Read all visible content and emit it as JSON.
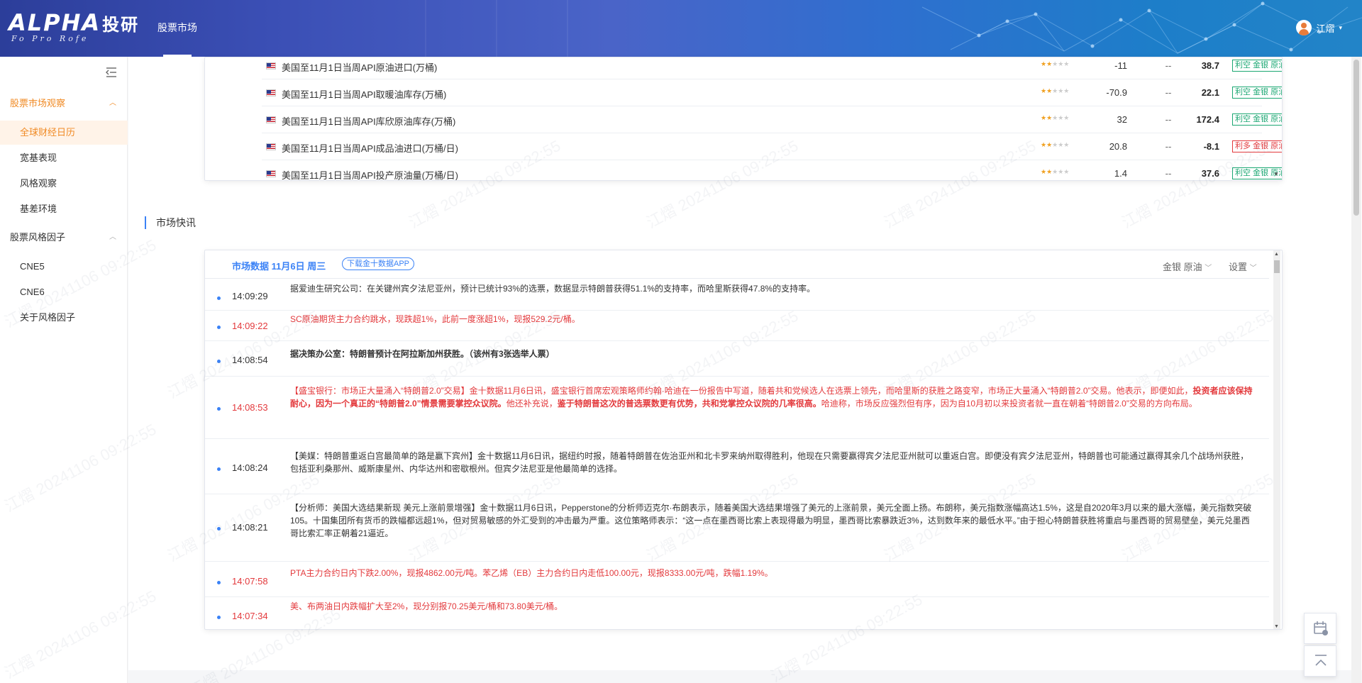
{
  "header": {
    "logo_text": "ALPHA",
    "logo_cn": "投研",
    "logo_sub": "Fo Pro Rofe",
    "nav_tab": "股票市场",
    "user_name": "江熠"
  },
  "sidebar": {
    "groups": [
      {
        "label": "股票市场观察",
        "items": [
          "全球财经日历",
          "宽基表现",
          "风格观察",
          "基差环境"
        ]
      },
      {
        "label": "股票风格因子",
        "items": [
          "CNE5",
          "CNE6",
          "关于风格因子"
        ]
      }
    ]
  },
  "econ_calendar": {
    "rows": [
      {
        "name": "美国至11月1日当周API原油进口(万桶)",
        "stars": 2,
        "prev": "-11",
        "expected": "--",
        "actual": "38.7",
        "tag": "利空 金银 原油",
        "tag_color": "#1aa772"
      },
      {
        "name": "美国至11月1日当周API取暖油库存(万桶)",
        "stars": 2,
        "prev": "-70.9",
        "expected": "--",
        "actual": "22.1",
        "tag": "利空 金银 原油",
        "tag_color": "#1aa772"
      },
      {
        "name": "美国至11月1日当周API库欣原油库存(万桶)",
        "stars": 2,
        "prev": "32",
        "expected": "--",
        "actual": "172.4",
        "tag": "利空 金银 原油",
        "tag_color": "#1aa772"
      },
      {
        "name": "美国至11月1日当周API成品油进口(万桶/日)",
        "stars": 2,
        "prev": "20.8",
        "expected": "--",
        "actual": "-8.1",
        "tag": "利多 金银 原油",
        "tag_color": "#e3393c"
      },
      {
        "name": "美国至11月1日当周API投产原油量(万桶/日)",
        "stars": 2,
        "prev": "1.4",
        "expected": "--",
        "actual": "37.6",
        "tag": "利空 金银 原油",
        "tag_color": "#1aa772"
      }
    ]
  },
  "section_title": "市场快讯",
  "news": {
    "title": "市场数据 11月6日 周三",
    "app_button": "下载金十数据APP",
    "filter_label": "金银 原油",
    "settings_label": "设置",
    "items": [
      {
        "time": "14:09:29",
        "text": "据爱迪生研究公司：在关键州宾夕法尼亚州，预计已统计93%的选票，数据显示特朗普获得51.1%的支持率，而哈里斯获得47.8%的支持率。"
      },
      {
        "time": "14:09:22",
        "text": "SC原油期货主力合约跳水，现跌超1%，此前一度涨超1%，现报529.2元/桶。"
      },
      {
        "time": "14:08:54",
        "text": "据决策办公室：特朗普预计在阿拉斯加州获胜。（该州有3张选举人票）"
      },
      {
        "time": "14:08:53",
        "text_a": "【盛宝银行：市场正大量涌入“特朗普2.0”交易】金十数据11月6日讯，盛宝银行首席宏观策略师约翰·哈迪在一份报告中写道，随着共和党候选人在选票上领先，而哈里斯的获胜之路变窄，市场正大量涌入“特朗普2.0”交易。他表示，即便如此，",
        "text_b": "投资者应该保持耐心，因为一个真正的“特朗普2.0”情景需要掌控众议院。",
        "text_c": "他还补充说，",
        "text_d": "鉴于特朗普这次的普选票数更有优势，共和党掌控众议院的几率很高。",
        "text_e": "哈迪称，市场反应强烈但有序，因为自10月初以来投资者就一直在朝着“特朗普2.0”交易的方向布局。"
      },
      {
        "time": "14:08:24",
        "text": "【美媒：特朗普重返白宫最简单的路是赢下宾州】金十数据11月6日讯，据纽约时报，随着特朗普在佐治亚州和北卡罗来纳州取得胜利，他现在只需要赢得宾夕法尼亚州就可以重返白宫。即便没有宾夕法尼亚州，特朗普也可能通过赢得其余几个战场州获胜，包括亚利桑那州、威斯康星州、内华达州和密歇根州。但宾夕法尼亚是他最简单的选择。"
      },
      {
        "time": "14:08:21",
        "text": "【分析师：美国大选结果新现 美元上涨前景增强】金十数据11月6日讯，Pepperstone的分析师迈克尔·布朗表示，随着美国大选结果增强了美元的上涨前景，美元全面上扬。布朗称，美元指数涨幅高达1.5%，这是自2020年3月以来的最大涨幅，美元指数突破105。十国集团所有货币的跌幅都远超1%，但对贸易敏感的外汇受到的冲击最为严重。这位策略师表示：“这一点在墨西哥比索上表现得最为明显，墨西哥比索暴跌近3%，达到数年来的最低水平。”由于担心特朗普获胜将重启与墨西哥的贸易壁垒，美元兑墨西哥比索汇率正朝着21逼近。"
      },
      {
        "time": "14:07:58",
        "text": "PTA主力合约日内下跌2.00%，现报4862.00元/吨。苯乙烯（EB）主力合约日内走低100.00元，现报8333.00元/吨，跌幅1.19%。"
      },
      {
        "time": "14:07:34",
        "text": "美、布两油日内跌幅扩大至2%，现分别报70.25美元/桶和73.80美元/桶。"
      }
    ]
  },
  "watermark": "江熠 20241106 09:22:55",
  "colors": {
    "accent_blue": "#3b82f6",
    "active_orange": "#f08a24",
    "up_red": "#e3393c",
    "down_green": "#1aa772"
  },
  "icons": [
    "menu-fold-icon",
    "chevron-up-icon",
    "us-flag-icon",
    "star-icon",
    "bar-chart-icon",
    "chevron-down-icon",
    "calendar-icon",
    "back-to-top-icon",
    "user-avatar-icon"
  ]
}
